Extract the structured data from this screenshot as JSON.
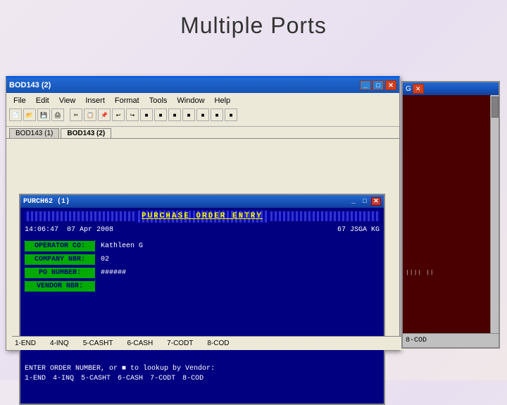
{
  "slide": {
    "title": "Multiple Ports"
  },
  "mainWindow": {
    "titlebar": "BOD143 (2)",
    "menus": [
      "File",
      "Edit",
      "View",
      "Insert",
      "Format",
      "Tools",
      "Window",
      "Help"
    ]
  },
  "tabs": [
    {
      "label": "BOD143 (1)"
    },
    {
      "label": "BOD143 (2)"
    }
  ],
  "terminal": {
    "titlebar": "PURCH62 (1)",
    "header": "PURCHASE ORDER ENTRY",
    "time": "14:06:47",
    "date": "07 Apr 2008",
    "operator": "67 JSGA KG",
    "fields": [
      {
        "label": "OPERATOR CO:",
        "value": "Kathleen G"
      },
      {
        "label": "COMPANY NBR:",
        "value": "02"
      },
      {
        "label": "PO NUMBER:",
        "value": "######"
      },
      {
        "label": "VENDOR NBR:",
        "value": ""
      }
    ],
    "enterLine": "ENTER ORDER NUMBER, or ■ to lookup by Vendor:",
    "functionKeys": [
      "1-END",
      "4-INQ",
      "5-CASHT",
      "6-CASH",
      "7-CODT",
      "8-COD"
    ]
  },
  "bottomBar": {
    "keys": [
      "1-END",
      "4-INQ",
      "5-CASHT",
      "6-CASH",
      "7-CODT",
      "8-COD"
    ]
  },
  "rightWindow": {
    "titlebar": "G",
    "scrollIndicator": "||||  ||"
  }
}
